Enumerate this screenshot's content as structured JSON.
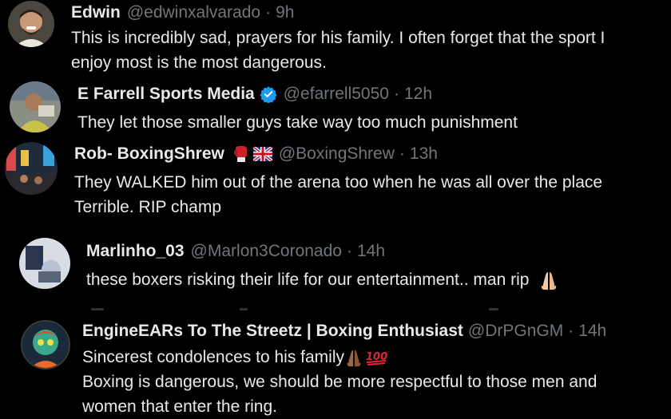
{
  "tweets": [
    {
      "name": "Edwin",
      "handle": "@edwinxalvarado",
      "time": "9h",
      "lines": [
        "This is incredibly sad, prayers for his family. I often forget that the sport I",
        "enjoy most is the most dangerous."
      ]
    },
    {
      "name": "E Farrell Sports Media",
      "handle": "@efarrell5050",
      "time": "12h",
      "verified": true,
      "lines": [
        "They let those smaller guys take way too much punishment"
      ]
    },
    {
      "name": "Rob- BoxingShrew",
      "handle": "@BoxingShrew",
      "time": "13h",
      "name_icons": [
        "boxing-glove-icon",
        "uk-flag-icon"
      ],
      "lines": [
        "They WALKED him out of the arena too when he was all over the place",
        "Terrible. RIP champ"
      ]
    },
    {
      "name": "Marlinho_03",
      "handle": "@Marlon3Coronado",
      "time": "14h",
      "lines": [
        "these boxers risking their life for our entertainment.. man rip"
      ],
      "trailing_icon": "folded-hands-icon"
    },
    {
      "name": "EngineEARs To The Streetz | Boxing Enthusiast",
      "handle": "@DrPGnGM",
      "time": "14h",
      "lines": [
        "Sincerest condolences to his family",
        "Boxing is dangerous, we should be more respectful to those men and",
        "women that enter the ring."
      ],
      "line1_icons": [
        "folded-hands-icon",
        "hundred-points-icon"
      ]
    }
  ],
  "separator": "·",
  "colors": {
    "background": "#000000",
    "text": "#e7e9ea",
    "secondary": "#71767b",
    "verified": "#1d9bf0"
  }
}
